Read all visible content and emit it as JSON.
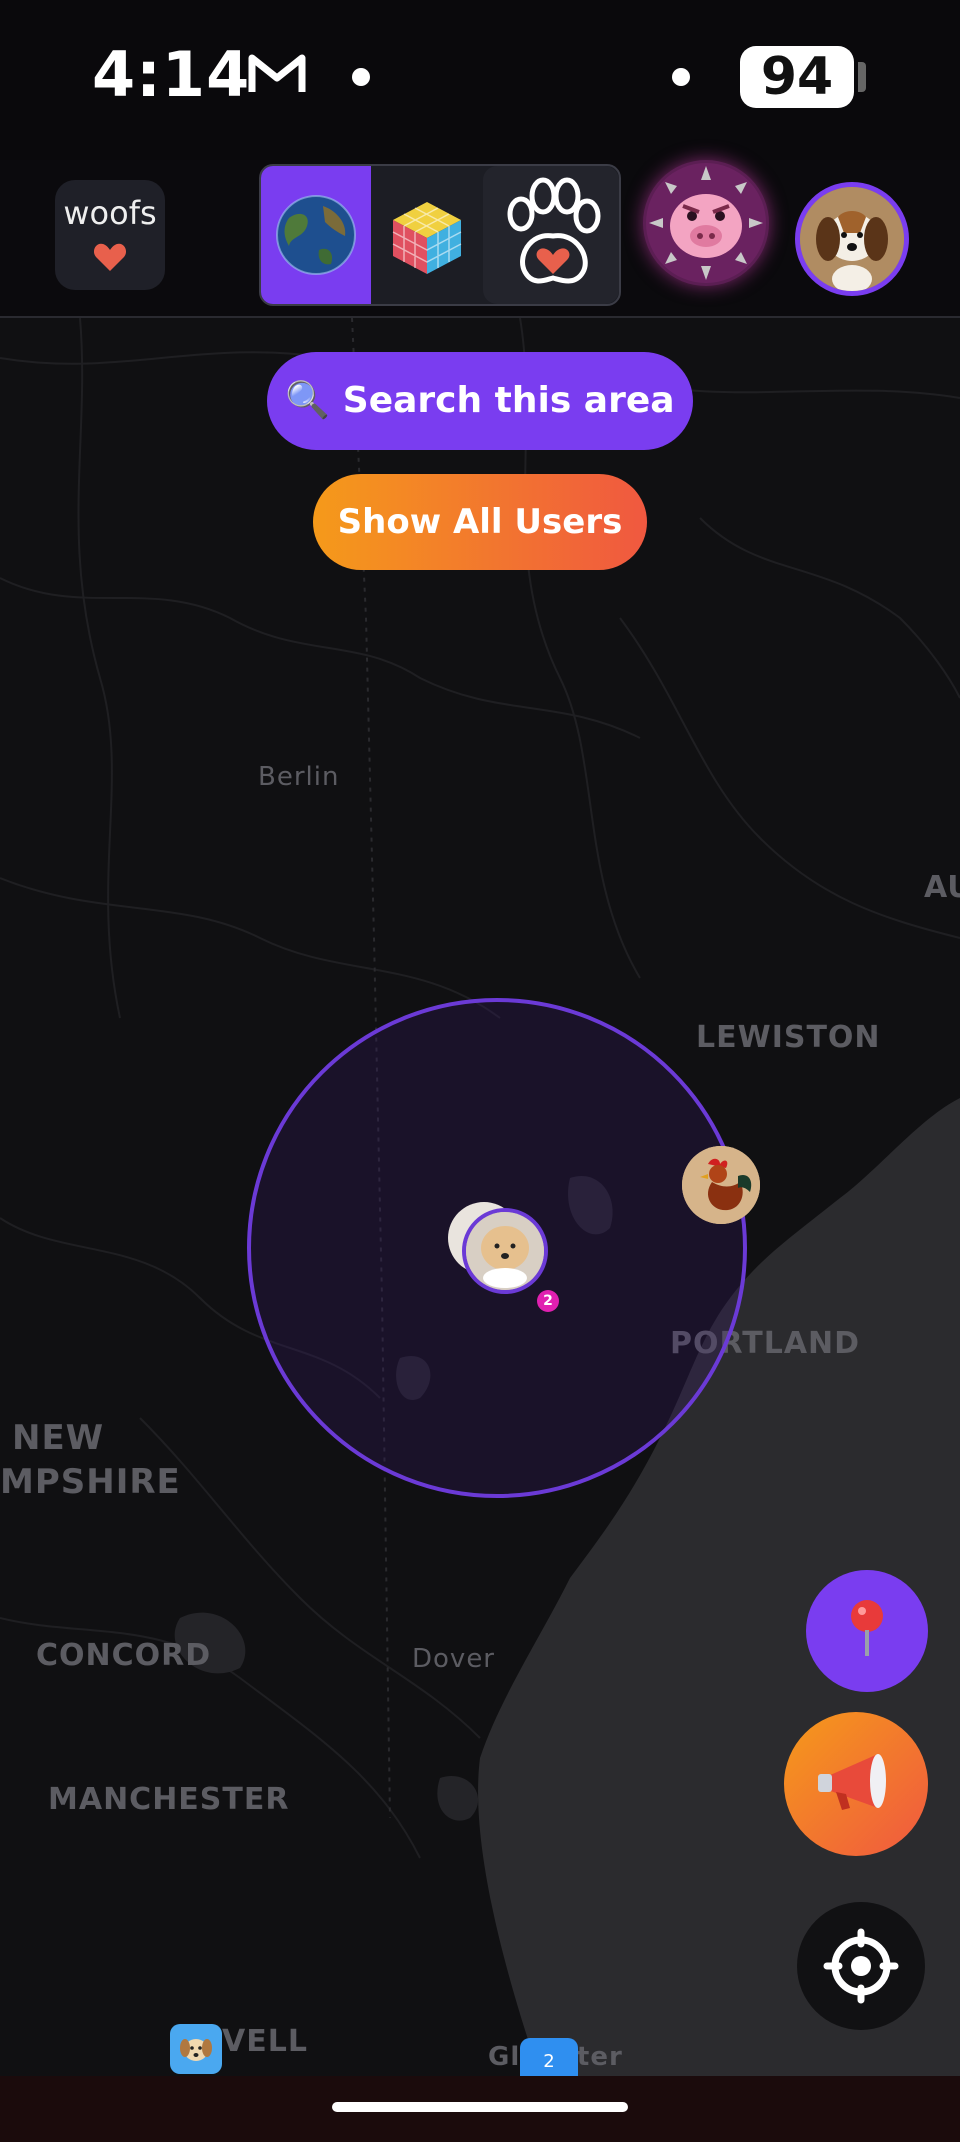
{
  "status_bar": {
    "time": "4:14",
    "battery": "94",
    "icons": [
      "gmail-icon",
      "notification-dot-icon",
      "notification-dot-icon"
    ]
  },
  "header": {
    "woofs_label": "woofs",
    "filters": [
      {
        "name": "globe",
        "icon": "globe-icon",
        "selected": true
      },
      {
        "name": "rainbow-cube",
        "icon": "rainbow-cube-icon",
        "selected": false
      },
      {
        "name": "paw-heart",
        "icon": "paw-heart-icon",
        "selected": false
      }
    ],
    "avatars": [
      "pig-avatar",
      "beagle-puppy-avatar"
    ],
    "accent_color": "#7a3df0"
  },
  "map": {
    "search_button": "🔍 Search this area",
    "show_all_button": "Show All Users",
    "labels": {
      "berlin": "Berlin",
      "lewiston": "LEWISTON",
      "portland": "PORTLAND",
      "new": "NEW",
      "mpshire": "MPSHIRE",
      "concord": "CONCORD",
      "dover": "Dover",
      "manchester": "MANCHESTER",
      "au": "AU",
      "vell": "VELL",
      "glster": "Gl    ster"
    },
    "marker_badge_count": "2",
    "cluster_count": "2"
  },
  "fabs": {
    "pin": "map-pin-icon",
    "megaphone": "megaphone-icon",
    "locate": "crosshair-icon"
  },
  "colors": {
    "primary": "#7a3df0",
    "orange_gradient_start": "#f59a1a",
    "orange_gradient_end": "#f05840",
    "map_background": "#101012",
    "ocean": "#2b2b2e"
  }
}
